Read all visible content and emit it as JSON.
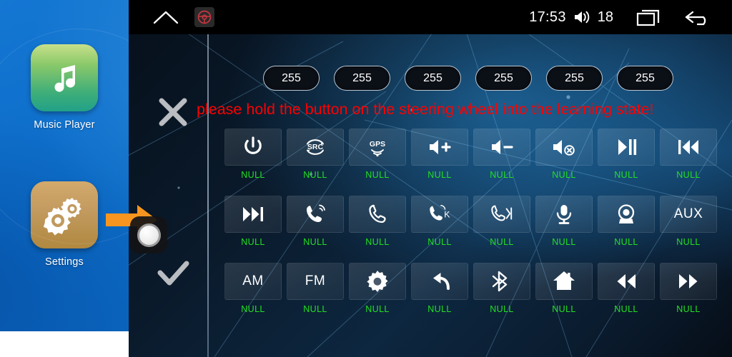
{
  "sidebar": {
    "apps": [
      {
        "label": "Music Player",
        "icon": "music-note-icon",
        "color": "#3fae79"
      },
      {
        "label": "Settings",
        "icon": "gears-icon",
        "color": "#b0883f"
      }
    ]
  },
  "statusbar": {
    "home_icon": "home-outline-icon",
    "steering_wheel_icon": "steering-wheel-icon",
    "time": "17:53",
    "volume_icon": "volume-icon",
    "volume_level": "18",
    "recents_icon": "recents-icon",
    "back_icon": "back-arrow-icon"
  },
  "panel": {
    "cancel_icon": "close-x-icon",
    "confirm_icon": "check-icon",
    "pointer_icon": "orange-arrow-right-icon",
    "cursor_icon": "circle-knob-icon",
    "warning_text": "please hold the button on the steering wheel into the learning state!",
    "warning_color": "#fe0000",
    "label_color": "#22e024",
    "pills": [
      {
        "value": "255"
      },
      {
        "value": "255"
      },
      {
        "value": "255"
      },
      {
        "value": "255"
      },
      {
        "value": "255"
      },
      {
        "value": "255"
      }
    ],
    "keys": [
      {
        "icon": "power-icon",
        "text": "",
        "label": "NULL"
      },
      {
        "icon": "src-icon",
        "text": "",
        "label": "NULL"
      },
      {
        "icon": "gps-icon",
        "text": "",
        "label": "NULL"
      },
      {
        "icon": "volume-up-icon",
        "text": "",
        "label": "NULL"
      },
      {
        "icon": "volume-down-icon",
        "text": "",
        "label": "NULL"
      },
      {
        "icon": "volume-mute-icon",
        "text": "",
        "label": "NULL"
      },
      {
        "icon": "play-pause-icon",
        "text": "",
        "label": "NULL"
      },
      {
        "icon": "previous-track-icon",
        "text": "",
        "label": "NULL"
      },
      {
        "icon": "next-track-icon",
        "text": "",
        "label": "NULL"
      },
      {
        "icon": "phone-answer-icon",
        "text": "",
        "label": "NULL"
      },
      {
        "icon": "phone-hangup-icon",
        "text": "",
        "label": "NULL"
      },
      {
        "icon": "phone-answer-k-icon",
        "text": "",
        "label": "NULL"
      },
      {
        "icon": "phone-hangup-end-icon",
        "text": "",
        "label": "NULL"
      },
      {
        "icon": "microphone-icon",
        "text": "",
        "label": "NULL"
      },
      {
        "icon": "camera-icon",
        "text": "",
        "label": "NULL"
      },
      {
        "icon": "",
        "text": "AUX",
        "label": "NULL"
      },
      {
        "icon": "",
        "text": "AM",
        "label": "NULL"
      },
      {
        "icon": "",
        "text": "FM",
        "label": "NULL"
      },
      {
        "icon": "gear-icon",
        "text": "",
        "label": "NULL"
      },
      {
        "icon": "back-undo-icon",
        "text": "",
        "label": "NULL"
      },
      {
        "icon": "bluetooth-icon",
        "text": "",
        "label": "NULL"
      },
      {
        "icon": "home-icon",
        "text": "",
        "label": "NULL"
      },
      {
        "icon": "rewind-icon",
        "text": "",
        "label": "NULL"
      },
      {
        "icon": "fast-forward-icon",
        "text": "",
        "label": "NULL"
      }
    ]
  }
}
